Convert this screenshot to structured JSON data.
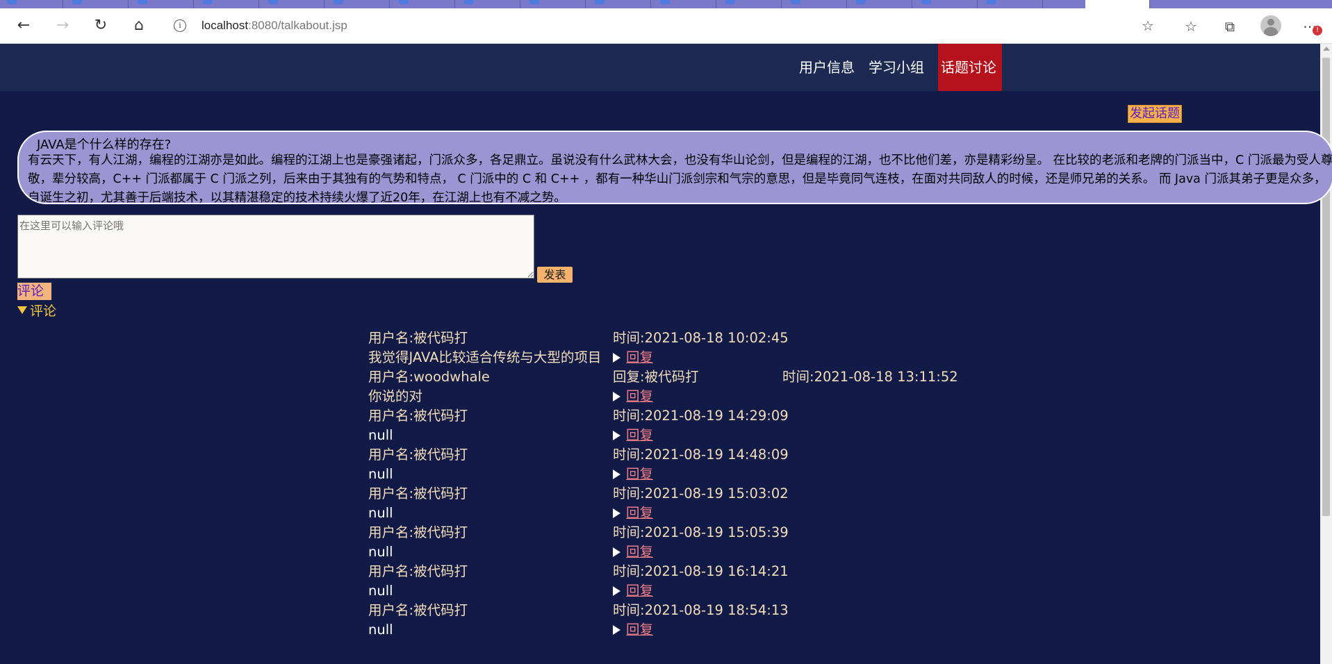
{
  "browser": {
    "url_host": "localhost",
    "url_rest": ":8080/talkabout.jsp"
  },
  "nav": {
    "items": [
      "用户信息",
      "学习小组",
      "话题讨论"
    ],
    "active_index": 2
  },
  "actions": {
    "start_topic": "发起话题",
    "publish": "发表",
    "comment_button": "评论",
    "comments_summary": "评论"
  },
  "topic": {
    "title": "JAVA是个什么样的存在?",
    "body": "有云天下，有人江湖，编程的江湖亦是如此。编程的江湖上也是豪强诸起，门派众多，各足鼎立。虽说没有什么武林大会，也没有华山论剑，但是编程的江湖，也不比他们差，亦是精彩纷呈。 在比较的老派和老牌的门派当中，C 门派最为受人尊敬，辈分较高，C++ 门派都属于 C 门派之列，后来由于其独有的气势和特点， C 门派中的 C 和 C++ ，都有一种华山门派剑宗和气宗的意思，但是毕竟同气连枝，在面对共同敌人的时候，还是师兄弟的关系。 而 Java 门派其弟子更是众多，自诞生之初，尤其善于后端技术，以其精湛稳定的技术持续火爆了近20年，在江湖上也有不减之势。"
  },
  "comment_input": {
    "placeholder": "在这里可以输入评论哦"
  },
  "comments": [
    {
      "user": "用户名:被代码打",
      "time": "时间:2021-08-18 10:02:45",
      "content": "我觉得JAVA比较适合传统与大型的项目",
      "reply_label": "回复"
    },
    {
      "user": "用户名:woodwhale",
      "reply_to": "回复:被代码打",
      "time": "时间:2021-08-18 13:11:52",
      "content": "你说的对",
      "reply_label": "回复"
    },
    {
      "user": "用户名:被代码打",
      "time": "时间:2021-08-19 14:29:09",
      "content": "null",
      "reply_label": "回复"
    },
    {
      "user": "用户名:被代码打",
      "time": "时间:2021-08-19 14:48:09",
      "content": "null",
      "reply_label": "回复"
    },
    {
      "user": "用户名:被代码打",
      "time": "时间:2021-08-19 15:03:02",
      "content": "null",
      "reply_label": "回复"
    },
    {
      "user": "用户名:被代码打",
      "time": "时间:2021-08-19 15:05:39",
      "content": "null",
      "reply_label": "回复"
    },
    {
      "user": "用户名:被代码打",
      "time": "时间:2021-08-19 16:14:21",
      "content": "null",
      "reply_label": "回复"
    },
    {
      "user": "用户名:被代码打",
      "time": "时间:2021-08-19 18:54:13",
      "content": "null",
      "reply_label": "回复"
    }
  ],
  "colors": {
    "page_bg": "#121a48",
    "nav_bg": "#1c2a52",
    "nav_active": "#b5121b",
    "topic_bg": "#9b96d3",
    "button_orange": "#f4b14a",
    "link_pink": "#ee7e83"
  }
}
